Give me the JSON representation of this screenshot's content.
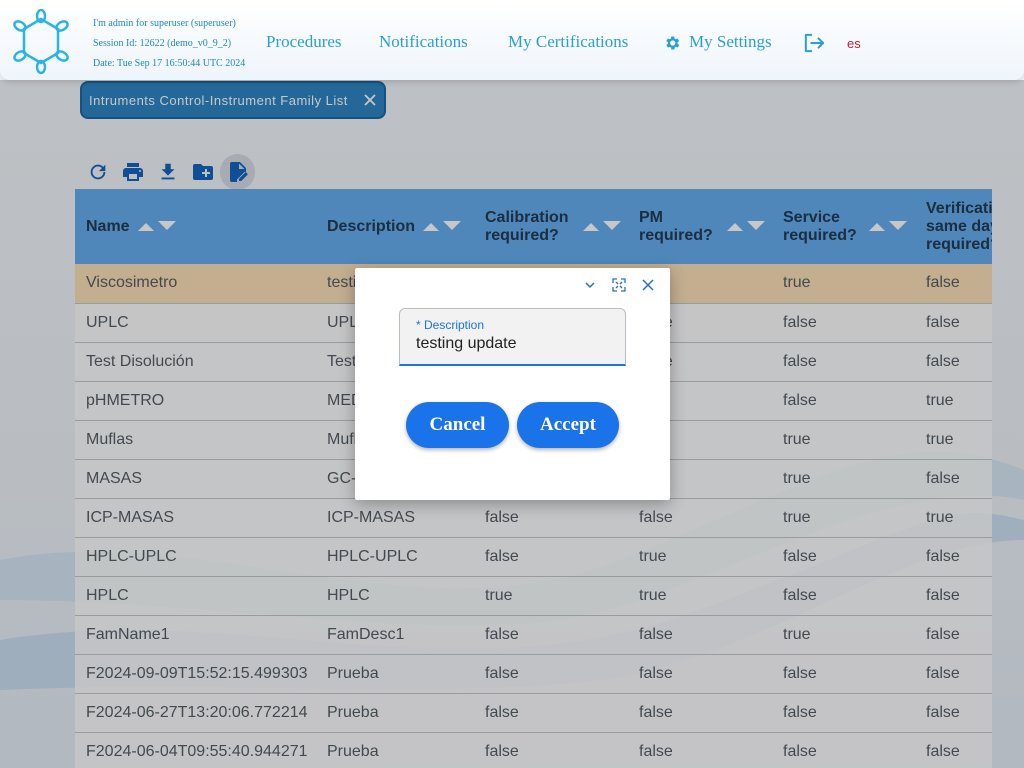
{
  "header": {
    "session_user": "I'm admin for superuser (superuser)",
    "session_id": "Session Id: 12622 (demo_v0_9_2)",
    "session_date": "Date: Tue Sep 17 16:50:44 UTC 2024",
    "nav": {
      "procedures": "Procedures",
      "notifications": "Notifications",
      "certifications": "My Certifications",
      "settings": "My Settings"
    },
    "language": "es"
  },
  "tab": {
    "label": "Intruments Control-Instrument Family List"
  },
  "toolbar": {
    "icons": [
      "refresh-icon",
      "print-icon",
      "download-icon",
      "new-folder-icon",
      "edit-icon"
    ]
  },
  "table": {
    "columns": [
      {
        "label": "Name"
      },
      {
        "label": "Description"
      },
      {
        "label": "Calibration required?"
      },
      {
        "label": "PM required?"
      },
      {
        "label": "Service required?"
      },
      {
        "label": "Verification same day required?"
      }
    ],
    "rows": [
      [
        "Viscosimetro",
        "testing update",
        "",
        "",
        "true",
        "false"
      ],
      [
        "UPLC",
        "UPLC",
        "",
        "false",
        "false",
        "false"
      ],
      [
        "Test Disolución",
        "Test Disolución",
        "",
        "false",
        "false",
        "false"
      ],
      [
        "pHMETRO",
        "MEDIDOR pH",
        "",
        "",
        "false",
        "true"
      ],
      [
        "Muflas",
        "Muflas",
        "",
        "",
        "true",
        "true"
      ],
      [
        "MASAS",
        "GC-MASAS",
        "",
        "",
        "true",
        "false"
      ],
      [
        "ICP-MASAS",
        "ICP-MASAS",
        "false",
        "false",
        "true",
        "true"
      ],
      [
        "HPLC-UPLC",
        "HPLC-UPLC",
        "false",
        "true",
        "false",
        "false"
      ],
      [
        "HPLC",
        "HPLC",
        "true",
        "true",
        "false",
        "false"
      ],
      [
        "FamName1",
        "FamDesc1",
        "false",
        "false",
        "true",
        "false"
      ],
      [
        "F2024-09-09T15:52:15.499303",
        "Prueba",
        "false",
        "false",
        "false",
        "false"
      ],
      [
        "F2024-06-27T13:20:06.772214",
        "Prueba",
        "false",
        "false",
        "false",
        "false"
      ],
      [
        "F2024-06-04T09:55:40.944271",
        "Prueba",
        "false",
        "false",
        "false",
        "false"
      ]
    ]
  },
  "dialog": {
    "field_label": "* Description",
    "field_value": "testing update",
    "cancel": "Cancel",
    "accept": "Accept"
  },
  "colors": {
    "accent": "#1a73e8",
    "header_link": "#2a9fd6",
    "table_header": "#66aef0",
    "selected_row": "#fbdfb9",
    "tab_chip": "#2f86c4"
  }
}
